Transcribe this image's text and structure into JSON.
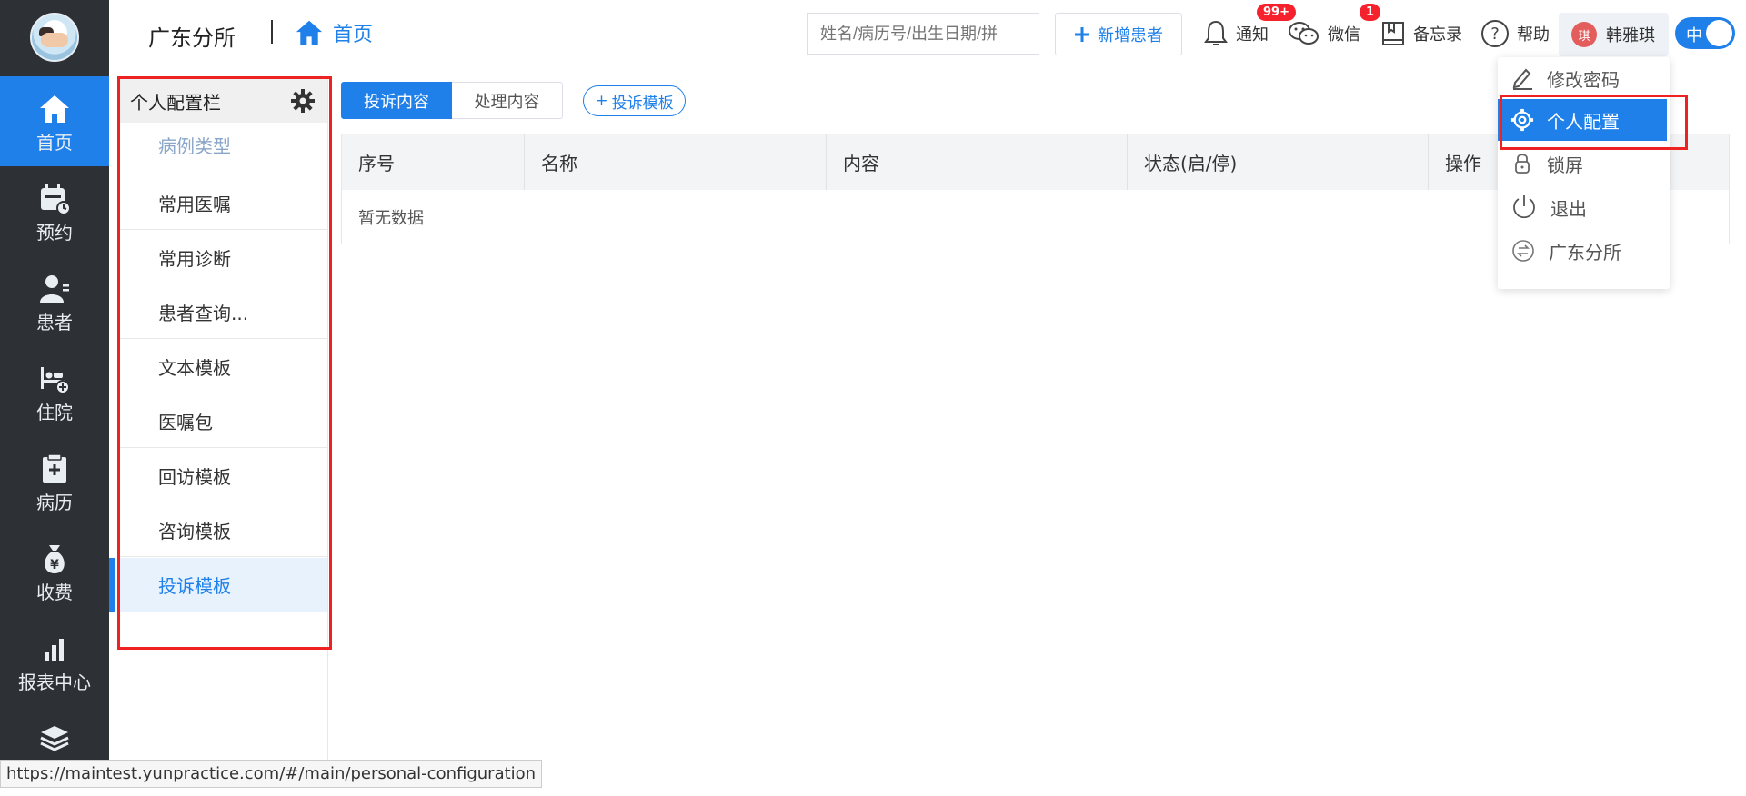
{
  "org_name": "广东分所",
  "breadcrumb": {
    "home": "首页"
  },
  "search": {
    "placeholder": "姓名/病历号/出生日期/拼"
  },
  "actions": {
    "add_patient": "新增患者"
  },
  "header_items": {
    "notify": {
      "label": "通知",
      "badge": "99+"
    },
    "wechat": {
      "label": "微信",
      "badge": "1"
    },
    "memo": {
      "label": "备忘录"
    },
    "help": {
      "label": "帮助"
    }
  },
  "user": {
    "name": "韩雅琪",
    "avatar_text": "琪"
  },
  "lang_toggle": "中",
  "sidebar": [
    {
      "label": "首页",
      "icon": "home-icon"
    },
    {
      "label": "预约",
      "icon": "calendar-icon"
    },
    {
      "label": "患者",
      "icon": "patient-icon"
    },
    {
      "label": "住院",
      "icon": "bed-icon"
    },
    {
      "label": "病历",
      "icon": "record-icon"
    },
    {
      "label": "收费",
      "icon": "money-bag-icon"
    },
    {
      "label": "报表中心",
      "icon": "bar-chart-icon"
    },
    {
      "label": "",
      "icon": "layers-icon"
    }
  ],
  "config_panel": {
    "title": "个人配置栏",
    "items": [
      "病例类型",
      "常用医嘱",
      "常用诊断",
      "患者查询...",
      "文本模板",
      "医嘱包",
      "回访模板",
      "咨询模板",
      "投诉模板"
    ],
    "active_index": 8
  },
  "tabs": [
    "投诉内容",
    "处理内容"
  ],
  "template_button": "投诉模板",
  "table": {
    "columns": [
      "序号",
      "名称",
      "内容",
      "状态(启/停)",
      "操作"
    ],
    "empty_text": "暂无数据"
  },
  "dropdown": [
    "修改密码",
    "个人配置",
    "锁屏",
    "退出",
    "广东分所"
  ],
  "status_url": "https://maintest.yunpractice.com/#/main/personal-configuration",
  "colors": {
    "primary": "#1f80ea",
    "sidebar_bg": "#2d3035",
    "badge": "#f5222d",
    "highlight_box": "#e22222"
  }
}
